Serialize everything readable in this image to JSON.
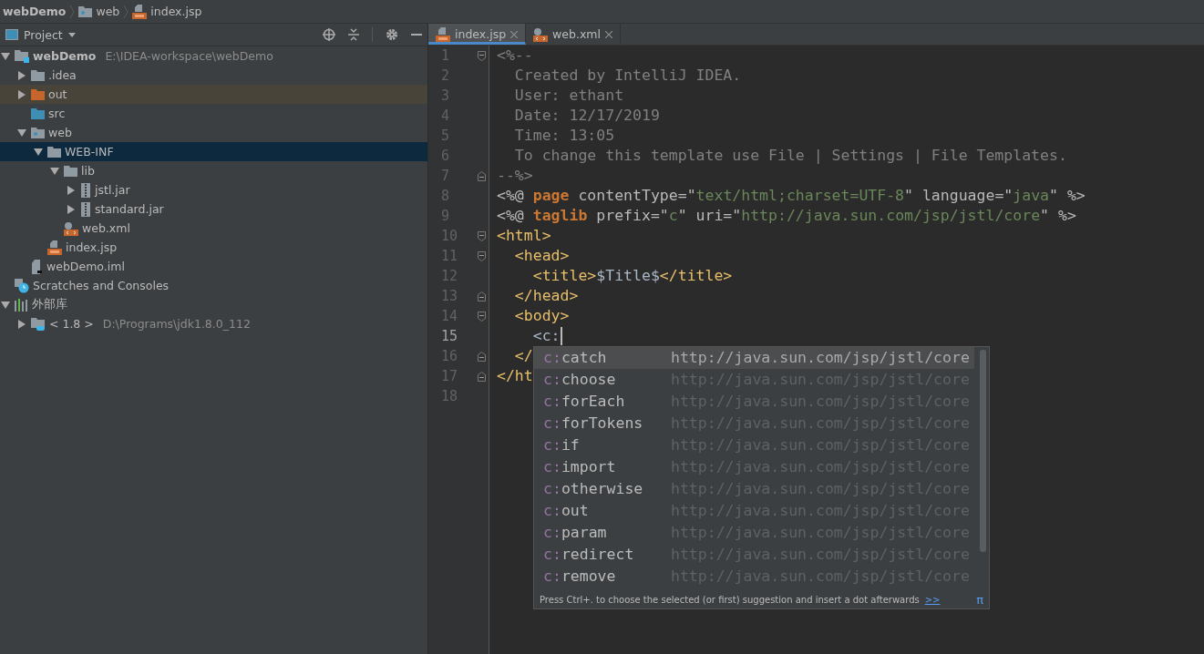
{
  "breadcrumbs": [
    {
      "label": "webDemo"
    },
    {
      "label": "web",
      "kind": "web-folder"
    },
    {
      "label": "index.jsp",
      "kind": "jsp"
    }
  ],
  "project_panel": {
    "title": "Project"
  },
  "tree": [
    {
      "label": "webDemo",
      "hint": "E:\\IDEA-workspace\\webDemo",
      "kind": "module",
      "expanded": true,
      "selected": false,
      "children": [
        {
          "label": ".idea",
          "kind": "folder",
          "expanded": false,
          "selected": false
        },
        {
          "label": "out",
          "kind": "excluded-folder",
          "expanded": false,
          "selected": false
        },
        {
          "label": "src",
          "kind": "source-folder",
          "selected": false
        },
        {
          "label": "web",
          "kind": "web-folder",
          "expanded": true,
          "selected": false,
          "children": [
            {
              "label": "WEB-INF",
              "kind": "folder",
              "expanded": true,
              "selected": true,
              "children": [
                {
                  "label": "lib",
                  "kind": "folder",
                  "expanded": true,
                  "selected": false,
                  "children": [
                    {
                      "label": "jstl.jar",
                      "kind": "jar",
                      "expanded": false,
                      "selected": false
                    },
                    {
                      "label": "standard.jar",
                      "kind": "jar",
                      "expanded": false,
                      "selected": false
                    }
                  ]
                },
                {
                  "label": "web.xml",
                  "kind": "xml",
                  "selected": false
                }
              ]
            },
            {
              "label": "index.jsp",
              "kind": "jsp",
              "selected": false
            }
          ]
        },
        {
          "label": "webDemo.iml",
          "kind": "iml",
          "selected": false
        }
      ]
    },
    {
      "label": "Scratches and Consoles",
      "kind": "scratches",
      "selected": false
    },
    {
      "label": "外部库",
      "kind": "libraries",
      "expanded": true,
      "selected": false,
      "children": [
        {
          "label": "< 1.8 >",
          "hint": "D:\\Programs\\jdk1.8.0_112",
          "kind": "jdk",
          "expanded": false,
          "selected": false
        }
      ]
    }
  ],
  "tabs": [
    {
      "label": "index.jsp",
      "kind": "jsp",
      "selected": true
    },
    {
      "label": "web.xml",
      "kind": "xml",
      "selected": false
    }
  ],
  "code": {
    "lines": [
      {
        "number": "1",
        "fold": {
          "kind": "start"
        },
        "current": false,
        "segments": [
          {
            "kind": "comment",
            "text": "<%--"
          }
        ]
      },
      {
        "number": "2",
        "current": false,
        "segments": [
          {
            "kind": "comment",
            "text": "  Created by IntelliJ IDEA."
          }
        ]
      },
      {
        "number": "3",
        "current": false,
        "segments": [
          {
            "kind": "comment",
            "text": "  User: ethant"
          }
        ]
      },
      {
        "number": "4",
        "current": false,
        "segments": [
          {
            "kind": "comment",
            "text": "  Date: 12/17/2019"
          }
        ]
      },
      {
        "number": "5",
        "current": false,
        "segments": [
          {
            "kind": "comment",
            "text": "  Time: 13:05"
          }
        ]
      },
      {
        "number": "6",
        "current": false,
        "segments": [
          {
            "kind": "comment",
            "text": "  To change this template use File | Settings | File Templates."
          }
        ]
      },
      {
        "number": "7",
        "fold": {
          "kind": "end"
        },
        "current": false,
        "segments": [
          {
            "kind": "comment",
            "text": "--%>"
          }
        ]
      },
      {
        "number": "8",
        "current": false,
        "segments": [
          {
            "kind": "punct",
            "text": "<%@ "
          },
          {
            "kind": "keyword",
            "text": "page"
          },
          {
            "kind": "attr",
            "text": " contentType=\""
          },
          {
            "kind": "string",
            "text": "text/html;charset=UTF-8"
          },
          {
            "kind": "attr",
            "text": "\" language=\""
          },
          {
            "kind": "string",
            "text": "java"
          },
          {
            "kind": "punct",
            "text": "\" %>"
          }
        ]
      },
      {
        "number": "9",
        "current": false,
        "segments": [
          {
            "kind": "punct",
            "text": "<%@ "
          },
          {
            "kind": "keyword",
            "text": "taglib"
          },
          {
            "kind": "attr",
            "text": " prefix=\""
          },
          {
            "kind": "string",
            "text": "c"
          },
          {
            "kind": "attr",
            "text": "\" uri=\""
          },
          {
            "kind": "string",
            "text": "http://java.sun.com/jsp/jstl/core"
          },
          {
            "kind": "punct",
            "text": "\" %>"
          }
        ]
      },
      {
        "number": "10",
        "fold": {
          "kind": "start"
        },
        "current": false,
        "segments": [
          {
            "kind": "tag",
            "text": "<html>"
          }
        ]
      },
      {
        "number": "11",
        "fold": {
          "kind": "start"
        },
        "current": false,
        "segments": [
          {
            "kind": "tag",
            "text": "  <head>"
          }
        ]
      },
      {
        "number": "12",
        "current": false,
        "segments": [
          {
            "kind": "tag",
            "text": "    <title>"
          },
          {
            "kind": "plain",
            "text": "$Title$"
          },
          {
            "kind": "tag",
            "text": "</title>"
          }
        ]
      },
      {
        "number": "13",
        "fold": {
          "kind": "end"
        },
        "current": false,
        "segments": [
          {
            "kind": "tag",
            "text": "  </head>"
          }
        ]
      },
      {
        "number": "14",
        "fold": {
          "kind": "start"
        },
        "current": false,
        "segments": [
          {
            "kind": "tag",
            "text": "  <body>"
          }
        ]
      },
      {
        "number": "15",
        "current": true,
        "segments": [
          {
            "kind": "plain",
            "text": "    <c:"
          }
        ]
      },
      {
        "number": "16",
        "fold": {
          "kind": "end"
        },
        "current": false,
        "segments": [
          {
            "kind": "tag",
            "text": "  </"
          }
        ]
      },
      {
        "number": "17",
        "fold": {
          "kind": "end"
        },
        "current": false,
        "segments": [
          {
            "kind": "tag",
            "text": "</ht"
          }
        ]
      },
      {
        "number": "18",
        "current": false
      }
    ]
  },
  "completion": {
    "items": [
      {
        "prefix": "c:",
        "name": "catch",
        "source": "http://java.sun.com/jsp/jstl/core",
        "selected": true
      },
      {
        "prefix": "c:",
        "name": "choose",
        "source": "http://java.sun.com/jsp/jstl/core",
        "selected": false
      },
      {
        "prefix": "c:",
        "name": "forEach",
        "source": "http://java.sun.com/jsp/jstl/core",
        "selected": false
      },
      {
        "prefix": "c:",
        "name": "forTokens",
        "source": "http://java.sun.com/jsp/jstl/core",
        "selected": false
      },
      {
        "prefix": "c:",
        "name": "if",
        "source": "http://java.sun.com/jsp/jstl/core",
        "selected": false
      },
      {
        "prefix": "c:",
        "name": "import",
        "source": "http://java.sun.com/jsp/jstl/core",
        "selected": false
      },
      {
        "prefix": "c:",
        "name": "otherwise",
        "source": "http://java.sun.com/jsp/jstl/core",
        "selected": false
      },
      {
        "prefix": "c:",
        "name": "out",
        "source": "http://java.sun.com/jsp/jstl/core",
        "selected": false
      },
      {
        "prefix": "c:",
        "name": "param",
        "source": "http://java.sun.com/jsp/jstl/core",
        "selected": false
      },
      {
        "prefix": "c:",
        "name": "redirect",
        "source": "http://java.sun.com/jsp/jstl/core",
        "selected": false
      },
      {
        "prefix": "c:",
        "name": "remove",
        "source": "http://java.sun.com/jsp/jstl/core",
        "selected": false
      }
    ],
    "hint": "Press Ctrl+. to choose the selected (or first) suggestion and insert a dot afterwards",
    "hint_link": ">>",
    "pi": "π"
  }
}
